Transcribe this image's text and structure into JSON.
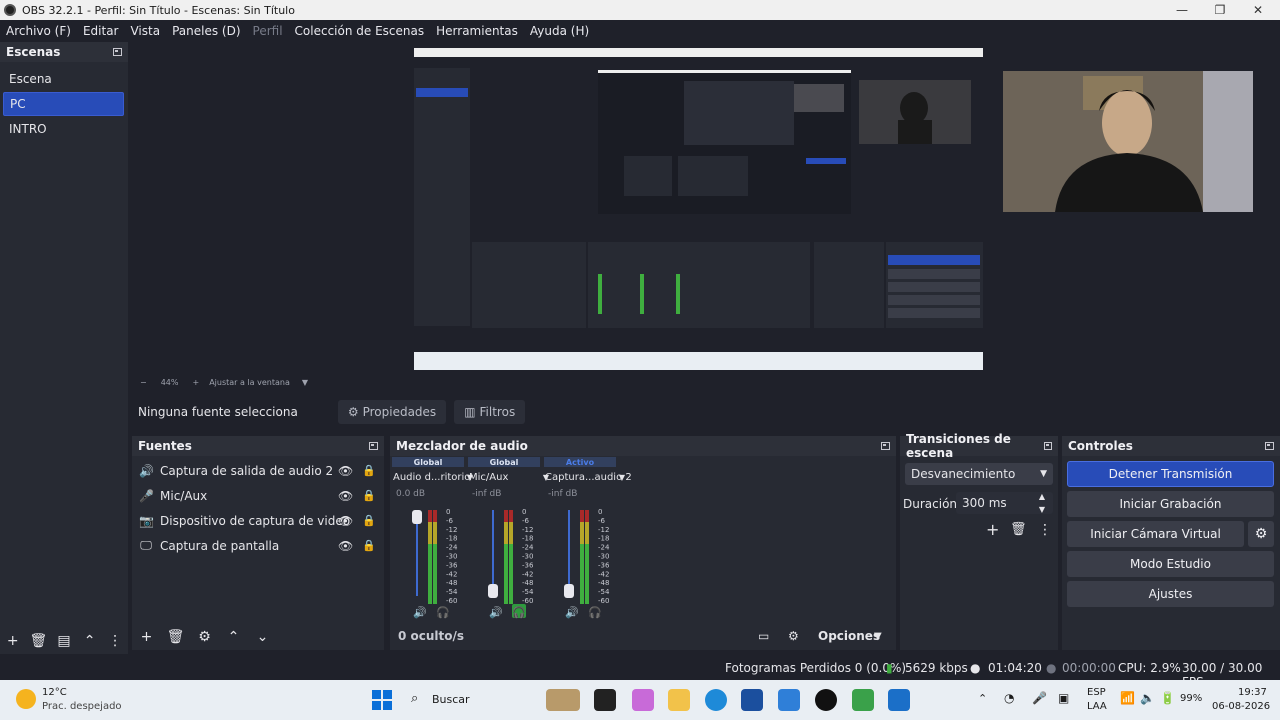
{
  "window": {
    "title": "OBS 32.2.1 - Perfil: Sin Título - Escenas: Sin Título",
    "controls": [
      "—",
      "❐",
      "✕"
    ]
  },
  "menu": [
    {
      "label": "Archivo (F)",
      "enabled": true
    },
    {
      "label": "Editar",
      "enabled": true
    },
    {
      "label": "Vista",
      "enabled": true
    },
    {
      "label": "Paneles (D)",
      "enabled": true
    },
    {
      "label": "Perfil",
      "enabled": false
    },
    {
      "label": "Colección de Escenas",
      "enabled": true
    },
    {
      "label": "Herramientas",
      "enabled": true
    },
    {
      "label": "Ayuda (H)",
      "enabled": true
    }
  ],
  "scenes": {
    "title": "Escenas",
    "items": [
      "Escena",
      "PC",
      "INTRO"
    ],
    "selected": "PC"
  },
  "preview": {
    "zoom": "44%",
    "zoom_minus": "−",
    "zoom_plus": "+",
    "fit_label": "Ajustar a la ventana"
  },
  "source_toolbar": {
    "status": "Ninguna fuente selecciona",
    "properties": "Propiedades",
    "filters": "Filtros"
  },
  "sources": {
    "title": "Fuentes",
    "items": [
      {
        "label": "Captura de salida de audio 2",
        "icon": "speaker-icon"
      },
      {
        "label": "Mic/Aux",
        "icon": "microphone-icon"
      },
      {
        "label": "Dispositivo de captura de video",
        "icon": "camera-icon"
      },
      {
        "label": "Captura de pantalla",
        "icon": "monitor-icon"
      }
    ]
  },
  "mixer": {
    "title": "Mezclador de audio",
    "channels": [
      {
        "tag": "Global",
        "name": "Audio d...ritorio",
        "db": "0.0 dB",
        "volume": 1.0,
        "monitor_active": false
      },
      {
        "tag": "Global",
        "name": "Mic/Aux",
        "db": "-inf dB",
        "volume": 0.0,
        "monitor_active": true
      },
      {
        "tag": "Activo",
        "name": "Captura...audio 2",
        "db": "-inf dB",
        "volume": 0.0,
        "monitor_active": false
      }
    ],
    "scale": [
      "0",
      "-6",
      "-12",
      "-18",
      "-24",
      "-30",
      "-36",
      "-42",
      "-48",
      "-54",
      "-60"
    ],
    "hidden": "0 oculto/s",
    "options": "Opciones"
  },
  "transitions": {
    "title": "Transiciones de escena",
    "selected": "Desvanecimiento",
    "duration_label": "Duración",
    "duration_value": "300 ms"
  },
  "controls": {
    "title": "Controles",
    "stop_stream": "Detener Transmisión",
    "start_record": "Iniciar Grabación",
    "start_vcam": "Iniciar Cámara Virtual",
    "studio": "Modo Estudio",
    "settings": "Ajustes"
  },
  "status": {
    "dropped": "Fotogramas Perdidos 0 (0.0%)",
    "bitrate": "5629 kbps",
    "stream_time": "01:04:20",
    "rec_time": "00:00:00",
    "cpu": "CPU: 2.9%",
    "fps": "30.00 / 30.00 FPS"
  },
  "taskbar": {
    "temp": "12°C",
    "weather": "Prac. despejado",
    "search": "Buscar",
    "lang1": "ESP",
    "lang2": "LAA",
    "battery": "99%",
    "time": "19:37",
    "date": "06-08-2026"
  },
  "colors": {
    "accent": "#284cb8",
    "panel": "#272a33",
    "background": "#1f212a",
    "meter_green": "#3fae3f",
    "meter_yellow": "#b6a629",
    "meter_red": "#a92929"
  }
}
